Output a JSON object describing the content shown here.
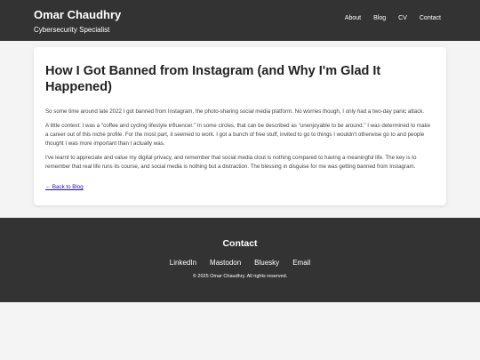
{
  "header": {
    "name": "Omar Chaudhry",
    "subtitle": "Cybersecurity Specialist",
    "nav": [
      "About",
      "Blog",
      "CV",
      "Contact"
    ]
  },
  "post": {
    "title": "How I Got Banned from Instagram (and Why I'm Glad It Happened)",
    "paragraphs": [
      "So some time around late 2022 I got banned from Instagram, the photo-sharing social media platform. No worries though, I only had a two-day panic attack.",
      "A little context: I was a \"coffee and cycling lifestyle influencer.\" In some circles, that can be described as \"unenjoyable to be around.\" I was determined to make a career out of this niche profile. For the most part, it seemed to work. I got a bunch of free stuff, invited to go to things I wouldn't otherwise go to and people thought I was more important than I actually was.",
      "I've learnt to appreciate and value my digital privacy, and remember that social media clout is nothing compared to having a meaningful life. The key is to remember that real life runs its course, and social media is nothing but a distraction. The blessing in disguise for me was getting banned from Instagram."
    ],
    "back_link": "← Back to Blog"
  },
  "footer": {
    "title": "Contact",
    "links": [
      "LinkedIn",
      "Mastodon",
      "Bluesky",
      "Email"
    ],
    "copyright": "© 2025 Omar Chaudhry. All rights reserved."
  }
}
